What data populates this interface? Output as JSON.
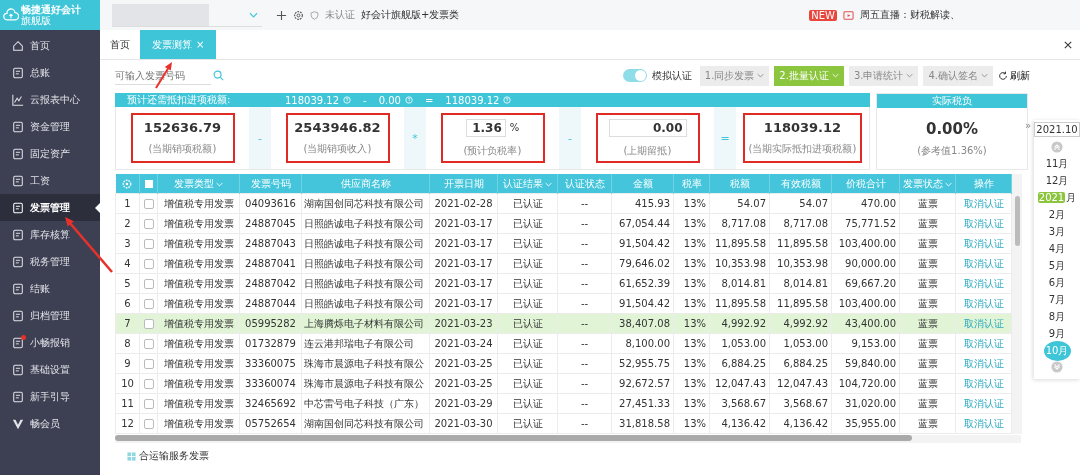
{
  "app": {
    "logo": "畅捷通好会计",
    "edition": "旗舰版",
    "cert": "未认证",
    "product": "好会计旗舰版+发票类",
    "news_badge": "NEW",
    "news": "周五直播：财税解读、"
  },
  "sidebar": {
    "items": [
      {
        "label": "首页",
        "selected": false
      },
      {
        "label": "总账",
        "selected": false
      },
      {
        "label": "云报表中心",
        "selected": false
      },
      {
        "label": "资金管理",
        "selected": false
      },
      {
        "label": "固定资产",
        "selected": false
      },
      {
        "label": "工资",
        "selected": false
      },
      {
        "label": "发票管理",
        "selected": true
      },
      {
        "label": "库存核算",
        "selected": false
      },
      {
        "label": "税务管理",
        "selected": false
      },
      {
        "label": "结账",
        "selected": false
      },
      {
        "label": "归档管理",
        "selected": false
      },
      {
        "label": "小畅报销",
        "selected": false,
        "dot": true
      },
      {
        "label": "基础设置",
        "selected": false
      },
      {
        "label": "新手引导",
        "selected": false
      },
      {
        "label": "畅会员",
        "selected": false
      }
    ]
  },
  "tabs": [
    {
      "label": "首页",
      "selected": false
    },
    {
      "label": "发票测算",
      "selected": true,
      "close": "×"
    }
  ],
  "toolbar": {
    "search_placeholder": "可输入发票号码",
    "toggle": {
      "label": "模拟认证",
      "on": true
    },
    "steps": [
      {
        "label": "1.同步发票",
        "disabled": true
      },
      {
        "label": "2.批量认证",
        "disabled": false
      },
      {
        "label": "3.申请统计",
        "disabled": true
      },
      {
        "label": "4.确认签名",
        "disabled": true
      }
    ],
    "refresh": "刷新"
  },
  "summary": {
    "title": "预计还需抵扣进项税额:",
    "formula": [
      {
        "kind": "value",
        "text": "118039.12"
      },
      {
        "kind": "op",
        "text": "-"
      },
      {
        "kind": "value",
        "text": "0.00"
      },
      {
        "kind": "op",
        "text": "="
      },
      {
        "kind": "value",
        "text": "118039.12"
      }
    ],
    "items": [
      {
        "kind": "value",
        "value": "152636.79",
        "caption": "(当期销项税额)",
        "highlighted": true
      },
      {
        "kind": "op",
        "text": "-"
      },
      {
        "kind": "value",
        "value": "2543946.82",
        "caption": "(当期销项收入)",
        "highlighted": true
      },
      {
        "kind": "op",
        "text": "*"
      },
      {
        "kind": "input",
        "value": "1.36",
        "unit": "%",
        "caption": "(预计负税率)",
        "highlighted": true
      },
      {
        "kind": "op",
        "text": "-"
      },
      {
        "kind": "input",
        "value": "0.00",
        "caption": "(上期留抵)",
        "highlighted": true
      },
      {
        "kind": "op",
        "text": "="
      },
      {
        "kind": "value",
        "value": "118039.12",
        "caption": "(当期实际抵扣进项税额)",
        "highlighted": true
      }
    ],
    "burden": {
      "title": "实际税负",
      "value": "0.00%",
      "caption": "(参考值1.36%)"
    }
  },
  "table": {
    "select_all": {
      "checked": false
    },
    "columns": [
      {
        "label": "发票类型",
        "sortable": true
      },
      {
        "label": "发票号码",
        "sortable": false
      },
      {
        "label": "供应商名称",
        "sortable": false
      },
      {
        "label": "开票日期",
        "sortable": false
      },
      {
        "label": "认证结果",
        "sortable": true
      },
      {
        "label": "认证状态",
        "sortable": false
      },
      {
        "label": "金额",
        "sortable": false
      },
      {
        "label": "税率",
        "sortable": false
      },
      {
        "label": "税额",
        "sortable": false
      },
      {
        "label": "有效税额",
        "sortable": false
      },
      {
        "label": "价税合计",
        "sortable": false
      },
      {
        "label": "发票状态",
        "sortable": true
      },
      {
        "label": "操作",
        "sortable": false
      }
    ],
    "rows": [
      {
        "no": "1",
        "checked": false,
        "selected": false,
        "cells": [
          "增值税专用发票",
          "04093616",
          "湖南国创同芯科技有限公司",
          "2021-02-28",
          "已认证",
          "--",
          "415.93",
          "13%",
          "54.07",
          "54.07",
          "470.00",
          "蓝票"
        ],
        "action": "取消认证"
      },
      {
        "no": "2",
        "checked": false,
        "selected": false,
        "cells": [
          "增值税专用发票",
          "24887045",
          "日照皓诚电子科技有限公司",
          "2021-03-17",
          "已认证",
          "--",
          "67,054.44",
          "13%",
          "8,717.08",
          "8,717.08",
          "75,771.52",
          "蓝票"
        ],
        "action": "取消认证"
      },
      {
        "no": "3",
        "checked": false,
        "selected": false,
        "cells": [
          "增值税专用发票",
          "24887043",
          "日照皓诚电子科技有限公司",
          "2021-03-17",
          "已认证",
          "--",
          "91,504.42",
          "13%",
          "11,895.58",
          "11,895.58",
          "103,400.00",
          "蓝票"
        ],
        "action": "取消认证"
      },
      {
        "no": "4",
        "checked": false,
        "selected": false,
        "cells": [
          "增值税专用发票",
          "24887041",
          "日照皓诚电子科技有限公司",
          "2021-03-17",
          "已认证",
          "--",
          "79,646.02",
          "13%",
          "10,353.98",
          "10,353.98",
          "90,000.00",
          "蓝票"
        ],
        "action": "取消认证"
      },
      {
        "no": "5",
        "checked": false,
        "selected": false,
        "cells": [
          "增值税专用发票",
          "24887042",
          "日照皓诚电子科技有限公司",
          "2021-03-17",
          "已认证",
          "--",
          "61,652.39",
          "13%",
          "8,014.81",
          "8,014.81",
          "69,667.20",
          "蓝票"
        ],
        "action": "取消认证"
      },
      {
        "no": "6",
        "checked": false,
        "selected": false,
        "cells": [
          "增值税专用发票",
          "24887044",
          "日照皓诚电子科技有限公司",
          "2021-03-17",
          "已认证",
          "--",
          "91,504.42",
          "13%",
          "11,895.58",
          "11,895.58",
          "103,400.00",
          "蓝票"
        ],
        "action": "取消认证"
      },
      {
        "no": "7",
        "checked": false,
        "selected": true,
        "cells": [
          "增值税专用发票",
          "05995282",
          "上海腾烁电子材料有限公司",
          "2021-03-23",
          "已认证",
          "--",
          "38,407.08",
          "13%",
          "4,992.92",
          "4,992.92",
          "43,400.00",
          "蓝票"
        ],
        "action": "取消认证"
      },
      {
        "no": "8",
        "checked": false,
        "selected": false,
        "cells": [
          "增值税专用发票",
          "01732879",
          "连云港邦瑞电子有限公司",
          "2021-03-24",
          "已认证",
          "--",
          "8,100.00",
          "13%",
          "1,053.00",
          "1,053.00",
          "9,153.00",
          "蓝票"
        ],
        "action": "取消认证"
      },
      {
        "no": "9",
        "checked": false,
        "selected": false,
        "cells": [
          "增值税专用发票",
          "33360075",
          "珠海市晨源电子科技有限公",
          "2021-03-25",
          "已认证",
          "--",
          "52,955.75",
          "13%",
          "6,884.25",
          "6,884.25",
          "59,840.00",
          "蓝票"
        ],
        "action": "取消认证"
      },
      {
        "no": "10",
        "checked": false,
        "selected": false,
        "cells": [
          "增值税专用发票",
          "33360074",
          "珠海市晨源电子科技有限公",
          "2021-03-25",
          "已认证",
          "--",
          "92,672.57",
          "13%",
          "12,047.43",
          "12,047.43",
          "104,720.00",
          "蓝票"
        ],
        "action": "取消认证"
      },
      {
        "no": "11",
        "checked": false,
        "selected": false,
        "cells": [
          "增值税专用发票",
          "32465692",
          "中芯雷号电子科技（广东）",
          "2021-03-29",
          "已认证",
          "--",
          "27,451.33",
          "13%",
          "3,568.67",
          "3,568.67",
          "31,020.00",
          "蓝票"
        ],
        "action": "取消认证"
      },
      {
        "no": "12",
        "checked": false,
        "selected": false,
        "cells": [
          "增值税专用发票",
          "05752654",
          "湖南国创同芯科技有限公司",
          "2021-03-30",
          "已认证",
          "--",
          "31,818.58",
          "13%",
          "4,136.42",
          "4,136.42",
          "35,955.00",
          "蓝票"
        ],
        "action": "取消认证"
      }
    ]
  },
  "footer": {
    "label": "合运输服务发票"
  },
  "calendar": {
    "expand": "»",
    "current": "2021.10",
    "months": [
      {
        "label": "11月",
        "selected": false
      },
      {
        "label": "12月",
        "selected": false
      },
      {
        "label": "月",
        "year": "2021",
        "selected": false
      },
      {
        "label": "2月",
        "selected": false
      },
      {
        "label": "3月",
        "selected": false
      },
      {
        "label": "4月",
        "selected": false
      },
      {
        "label": "5月",
        "selected": false
      },
      {
        "label": "6月",
        "selected": false
      },
      {
        "label": "7月",
        "selected": false
      },
      {
        "label": "8月",
        "selected": false
      },
      {
        "label": "9月",
        "selected": false
      },
      {
        "label": "10月",
        "selected": true
      }
    ]
  }
}
